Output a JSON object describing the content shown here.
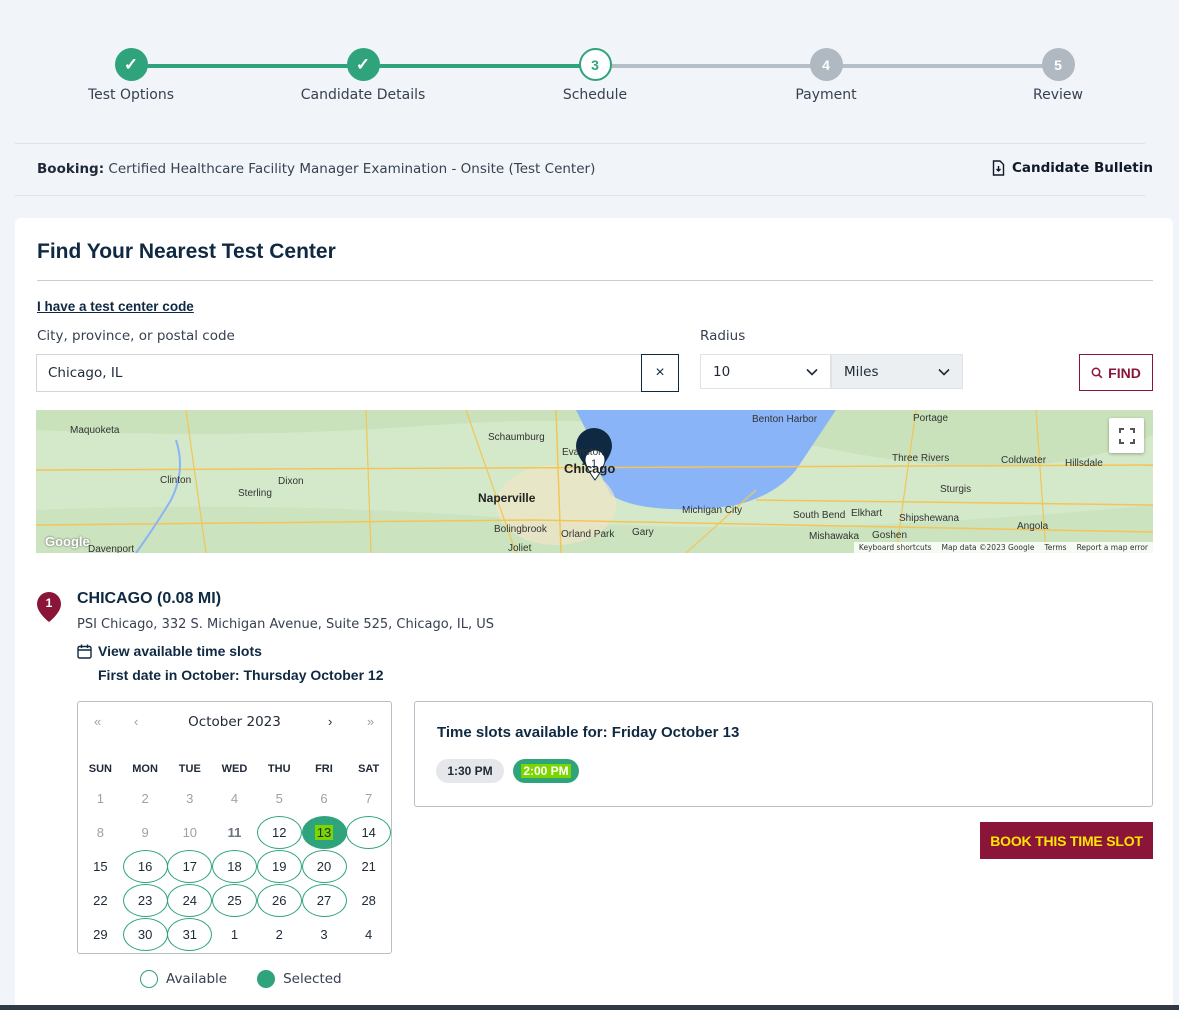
{
  "stepper": {
    "steps": [
      {
        "label": "Test Options",
        "marker": "✓"
      },
      {
        "label": "Candidate Details",
        "marker": "✓"
      },
      {
        "label": "Schedule",
        "marker": "3"
      },
      {
        "label": "Payment",
        "marker": "4"
      },
      {
        "label": "Review",
        "marker": "5"
      }
    ]
  },
  "booking": {
    "label": "Booking:",
    "value": "Certified Healthcare Facility Manager Examination - Onsite (Test Center)",
    "bulletin": "Candidate Bulletin"
  },
  "finder": {
    "title": "Find Your Nearest Test Center",
    "code_link": "I have a test center code",
    "city_label": "City, province, or postal code",
    "city_value": "Chicago, IL",
    "clear": "×",
    "radius_label": "Radius",
    "radius_value": "10",
    "units_value": "Miles",
    "find": "FIND"
  },
  "map": {
    "places": [
      "Maquoketa",
      "Schaumburg",
      "Benton Harbor",
      "Portage",
      "Three Rivers",
      "Coldwater",
      "Hillsdale",
      "Clinton",
      "Dixon",
      "Sterling",
      "Naperville",
      "Chicago",
      "Sturgis",
      "Michigan City",
      "South Bend",
      "Elkhart",
      "Shipshewana",
      "Angola",
      "Bolingbrook",
      "Orland Park",
      "Gary",
      "Mishawaka",
      "Goshen",
      "Joliet",
      "Davenport",
      "Evanston"
    ],
    "pin_label": "1",
    "google": "Google",
    "attribution": [
      "Keyboard shortcuts",
      "Map data ©2023 Google",
      "Terms",
      "Report a map error"
    ]
  },
  "result": {
    "index": "1",
    "name": "CHICAGO (0.08 MI)",
    "address": "PSI Chicago, 332 S. Michigan Avenue, Suite 525, Chicago, IL, US",
    "view_slots": "View available time slots",
    "first_date": "First date in October: Thursday October 12"
  },
  "calendar": {
    "month": "October 2023",
    "nav": {
      "prev_year": "«",
      "prev": "‹",
      "next": "›",
      "next_year": "»"
    },
    "days_of_week": [
      "SUN",
      "MON",
      "TUE",
      "WED",
      "THU",
      "FRI",
      "SAT"
    ],
    "weeks": [
      [
        {
          "d": "1",
          "s": "muted"
        },
        {
          "d": "2",
          "s": "muted"
        },
        {
          "d": "3",
          "s": "muted"
        },
        {
          "d": "4",
          "s": "muted"
        },
        {
          "d": "5",
          "s": "muted"
        },
        {
          "d": "6",
          "s": "muted"
        },
        {
          "d": "7",
          "s": "muted"
        }
      ],
      [
        {
          "d": "8",
          "s": "muted"
        },
        {
          "d": "9",
          "s": "muted"
        },
        {
          "d": "10",
          "s": "muted"
        },
        {
          "d": "11",
          "s": "bold"
        },
        {
          "d": "12",
          "s": "avail"
        },
        {
          "d": "13",
          "s": "selected"
        },
        {
          "d": "14",
          "s": "avail"
        }
      ],
      [
        {
          "d": "15",
          "s": "unavail"
        },
        {
          "d": "16",
          "s": "avail"
        },
        {
          "d": "17",
          "s": "avail"
        },
        {
          "d": "18",
          "s": "avail"
        },
        {
          "d": "19",
          "s": "avail"
        },
        {
          "d": "20",
          "s": "avail"
        },
        {
          "d": "21",
          "s": "unavail"
        }
      ],
      [
        {
          "d": "22",
          "s": "unavail"
        },
        {
          "d": "23",
          "s": "avail"
        },
        {
          "d": "24",
          "s": "avail"
        },
        {
          "d": "25",
          "s": "avail"
        },
        {
          "d": "26",
          "s": "avail"
        },
        {
          "d": "27",
          "s": "avail"
        },
        {
          "d": "28",
          "s": "unavail"
        }
      ],
      [
        {
          "d": "29",
          "s": "unavail"
        },
        {
          "d": "30",
          "s": "avail"
        },
        {
          "d": "31",
          "s": "avail"
        },
        {
          "d": "1",
          "s": "unavail"
        },
        {
          "d": "2",
          "s": "unavail"
        },
        {
          "d": "3",
          "s": "unavail"
        },
        {
          "d": "4",
          "s": "unavail"
        }
      ]
    ],
    "legend_available": "Available",
    "legend_selected": "Selected"
  },
  "slots": {
    "title": "Time slots available for: Friday October 13",
    "times": [
      "1:30 PM",
      "2:00 PM"
    ],
    "book": "BOOK THIS TIME SLOT"
  },
  "colors": {
    "accent": "#2ea37c",
    "brand": "#8a1538",
    "navy": "#0f2942",
    "highlight": "#7bd600"
  }
}
